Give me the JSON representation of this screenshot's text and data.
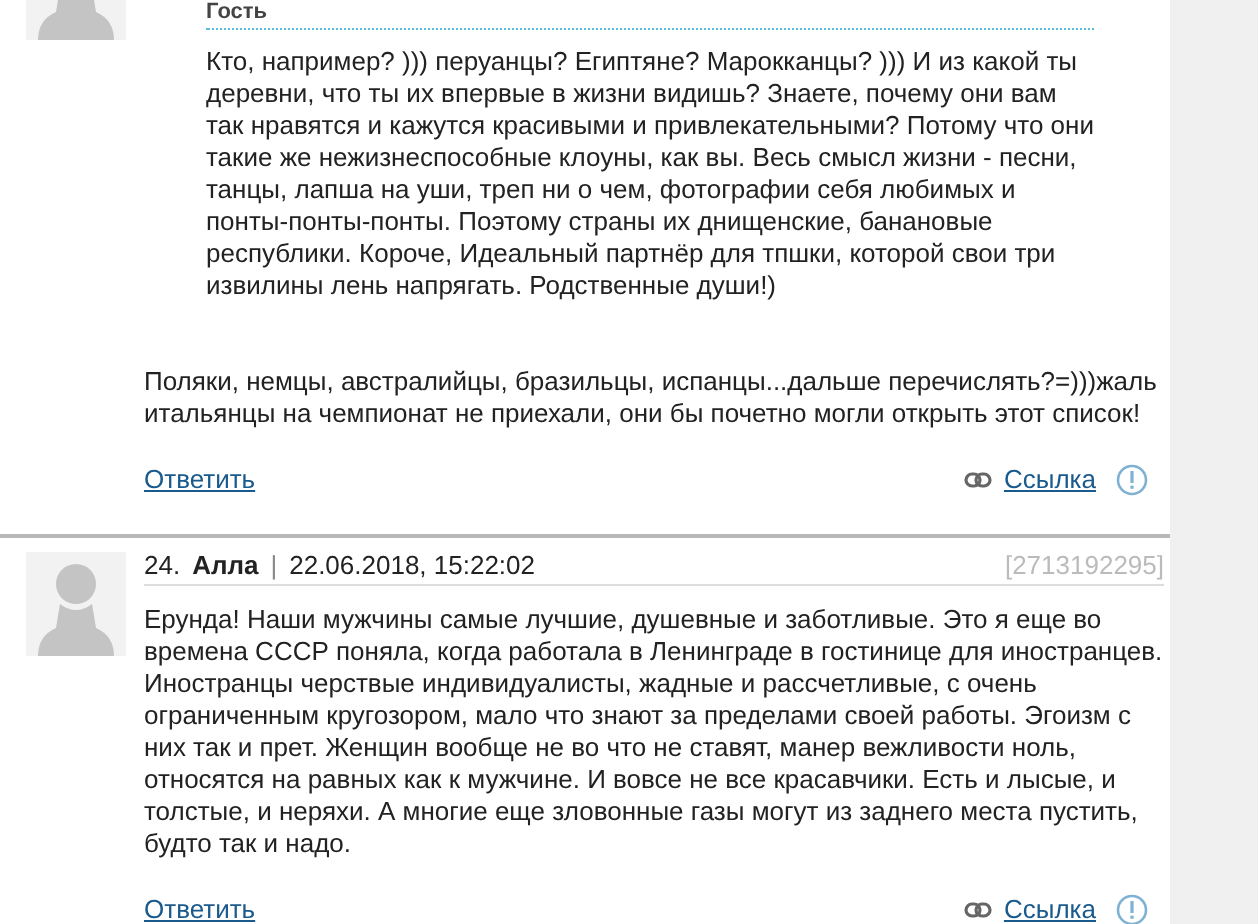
{
  "comments": [
    {
      "quote": {
        "author": "Гость",
        "text": "Кто, например? ))) перуанцы? Египтяне? Марокканцы? ))) И из какой ты деревни, что ты их впервые в жизни видишь? Знаете, почему они вам так нравятся и кажутся красивыми и привлекательными? Потому что они такие же нежизнеспособные клоуны, как вы. Весь смысл жизни - песни, танцы, лапша на уши, треп ни о чем, фотографии себя любимых и понты-понты-понты. Поэтому страны их днищенские, банановые республики. Короче, Идеальный партнёр для тпшки, которой свои три извилины лень напрягать. Родственные души!)"
      },
      "text": "Поляки, немцы, австралийцы, бразильцы, испанцы...дальше перечислять?=)))жаль итальянцы на чемпионат не приехали, они бы почетно могли открыть этот список!",
      "reply": "Ответить",
      "link": "Ссылка"
    },
    {
      "number": "24.",
      "author": "Алла",
      "separator": "|",
      "date": "22.06.2018, 15:22:02",
      "id": "[2713192295]",
      "text": "Ерунда! Наши мужчины самые лучшие, душевные и заботливые. Это я еще во времена СССР поняла, когда работала в Ленинграде в гостинице для иностранцев. Иностранцы черствые индивидуалисты, жадные и рассчетливые, с очень ограниченным кругозором, мало что знают за пределами своей работы. Эгоизм с них так и прет. Женщин вообще не во что не ставят, манер вежливости ноль, относятся на равных как к мужчине. И вовсе не все красавчики. Есть и лысые, и толстые, и неряхи. А многие еще зловонные газы могут из заднего места пустить, будто так и надо.",
      "reply": "Ответить",
      "link": "Ссылка"
    }
  ]
}
